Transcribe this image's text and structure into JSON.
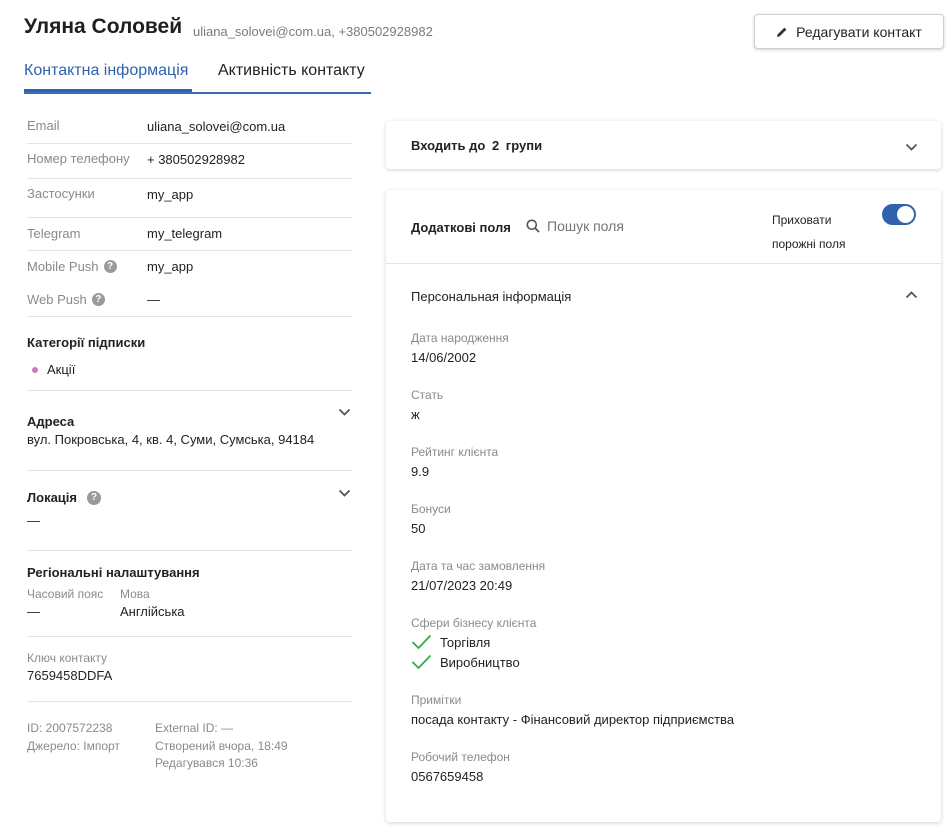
{
  "header": {
    "name": "Уляна Соловей",
    "subinfo": "uliana_solovei@com.ua, +380502928982",
    "edit_button": "Редагувати контакт"
  },
  "tabs": [
    {
      "label": "Контактна інформація",
      "active": true
    },
    {
      "label": "Активність контакту",
      "active": false
    }
  ],
  "channels": [
    {
      "label": "Email",
      "value": "uliana_solovei@com.ua",
      "help": false
    },
    {
      "label": "Номер телефону",
      "value": "+ 380502928982",
      "help": false
    },
    {
      "label": "Застосунки",
      "value": "my_app",
      "help": false
    },
    {
      "label": "Telegram",
      "value": "my_telegram",
      "help": false
    },
    {
      "label": "Mobile Push",
      "value": "my_app",
      "help": true
    },
    {
      "label": "Web Push",
      "value": "—",
      "help": true
    }
  ],
  "subscriptions": {
    "title": "Категорії підписки",
    "items": [
      "Акції"
    ],
    "dot_color": "#c77dc4"
  },
  "address": {
    "title": "Адреса",
    "value": "вул. Покровська, 4, кв. 4, Суми, Сумська, 94184"
  },
  "location": {
    "title": "Локація",
    "value": "—"
  },
  "regional": {
    "title": "Регіональні налаштування",
    "timezone_label": "Часовий пояс",
    "timezone_value": "—",
    "language_label": "Мова",
    "language_value": "Англійська"
  },
  "contact_key": {
    "label": "Ключ контакту",
    "value": "7659458DDFA"
  },
  "meta": {
    "id": "ID: 2007572238",
    "source": "Джерело:  Імпорт",
    "external_id": "External ID: —",
    "created": "Створений вчора, 18:49",
    "edited": "Редагувався 10:36"
  },
  "groups": {
    "prefix": "Входить до",
    "count": "2",
    "suffix": "групи"
  },
  "extra_fields": {
    "title": "Додаткові поля",
    "search_placeholder": "Пошук поля",
    "hide_empty_line1": "Приховати",
    "hide_empty_line2": "порожні поля",
    "hide_empty_on": true,
    "section_title": "Персональная інформація",
    "fields": {
      "birth": {
        "label": "Дата народження",
        "value": "14/06/2002"
      },
      "gender": {
        "label": "Стать",
        "value": "ж"
      },
      "rating": {
        "label": "Рейтинг клієнта",
        "value": "9.9"
      },
      "bonus": {
        "label": "Бонуси",
        "value": "50"
      },
      "order": {
        "label": "Дата та час замовлення",
        "value": "21/07/2023 20:49"
      },
      "business": {
        "label": "Сфери бізнесу клієнта",
        "values": [
          "Торгівля",
          "Виробництво"
        ]
      },
      "notes": {
        "label": "Примітки",
        "value": "посада контакту - Фінансовий директор підприємства"
      },
      "work_phone": {
        "label": "Робочий телефон",
        "value": "0567659458"
      }
    }
  },
  "colors": {
    "accent": "#2f62ad",
    "check": "#3aa64a"
  }
}
